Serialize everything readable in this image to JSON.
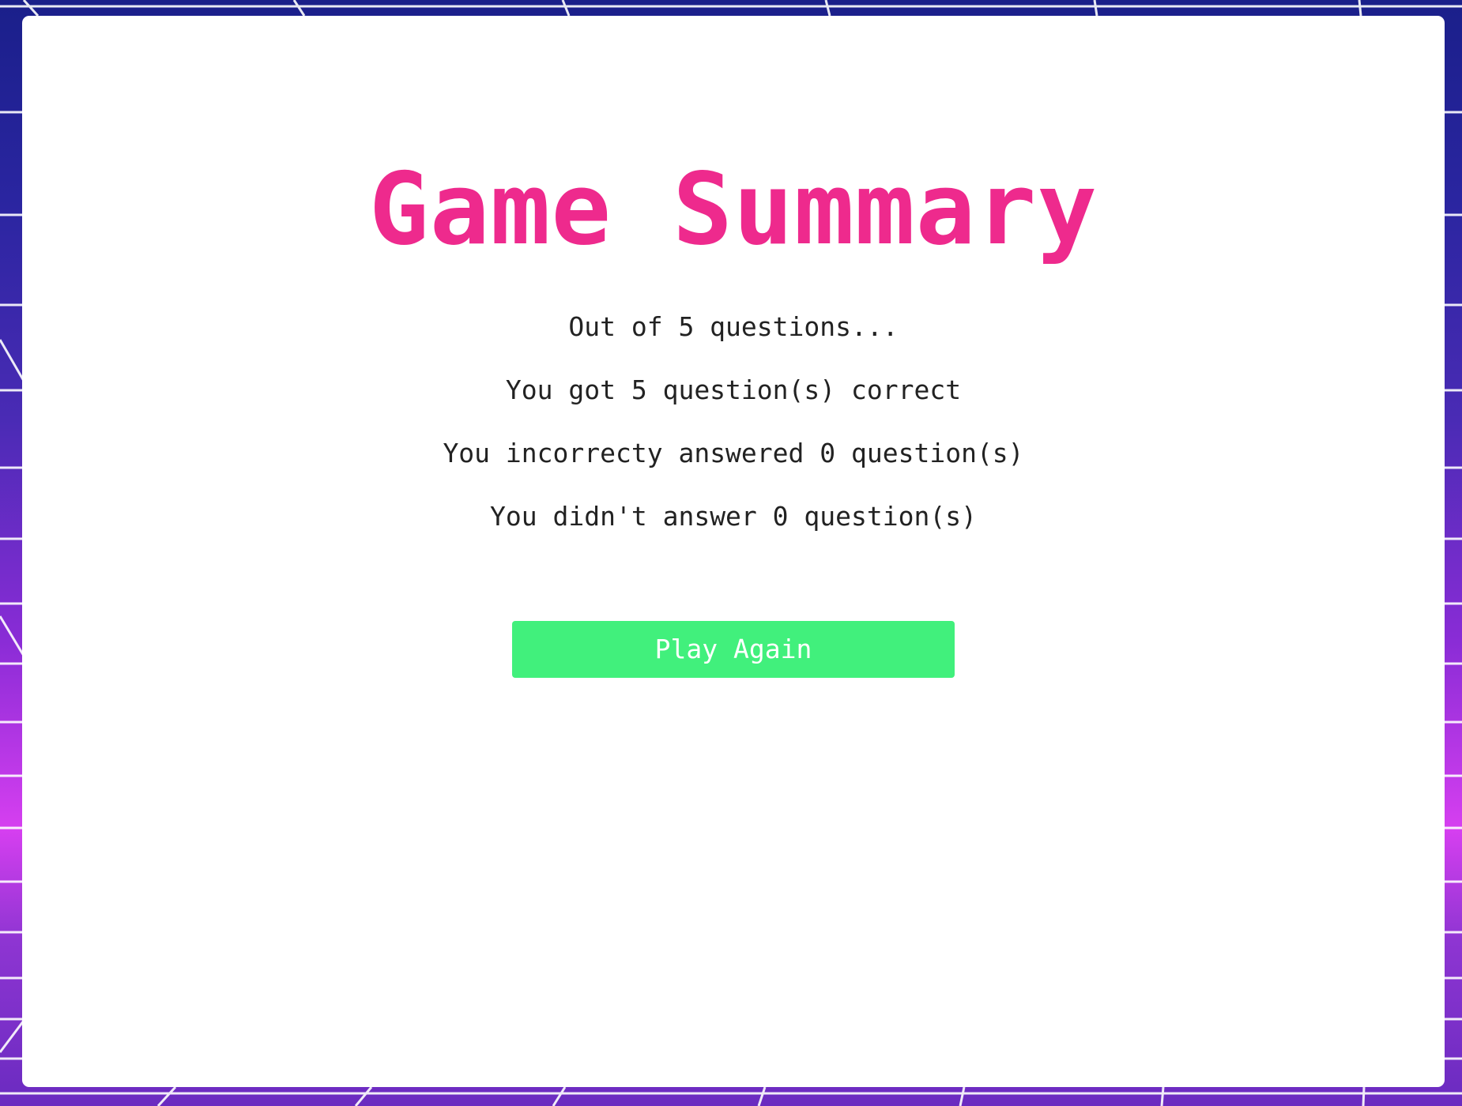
{
  "summary": {
    "title": "Game Summary",
    "out_of": "Out of 5 questions...",
    "correct": "You got 5 question(s) correct",
    "incorrect": "You incorrecty answered 0 question(s)",
    "unanswered": "You didn't answer 0 question(s)"
  },
  "actions": {
    "play_again_label": "Play Again"
  },
  "colors": {
    "title": "#ee2a8d",
    "button": "#41f07c",
    "text": "#222222",
    "card": "#ffffff",
    "background_top": "#1a1f8a",
    "background_glow": "#d63ff0",
    "grid_lines": "#ffffff"
  }
}
